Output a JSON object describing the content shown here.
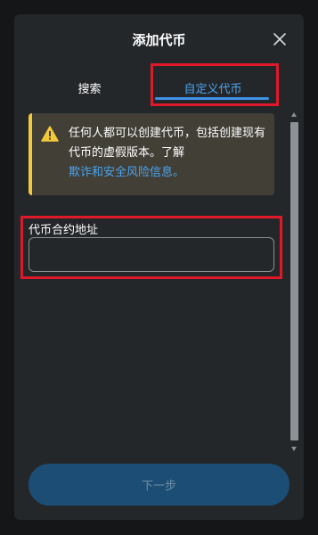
{
  "dialog": {
    "title": "添加代币"
  },
  "tabs": [
    {
      "label": "搜索"
    },
    {
      "label": "自定义代币"
    }
  ],
  "warning": {
    "text": "任何人都可以创建代币，包括创建现有代币的虚假版本。了解",
    "link_text": "欺诈和安全风险信息",
    "link_suffix": "。",
    "icon": "warning-triangle-icon",
    "accent_color": "#f1c93b"
  },
  "contract_field": {
    "label": "代币合约地址",
    "value": "",
    "placeholder": ""
  },
  "footer": {
    "next_label": "下一步"
  },
  "colors": {
    "background": "#141618",
    "modal": "#24272a",
    "primary": "#3d93e6",
    "highlight": "#e0192a",
    "button_disabled": "#1c4e75"
  }
}
